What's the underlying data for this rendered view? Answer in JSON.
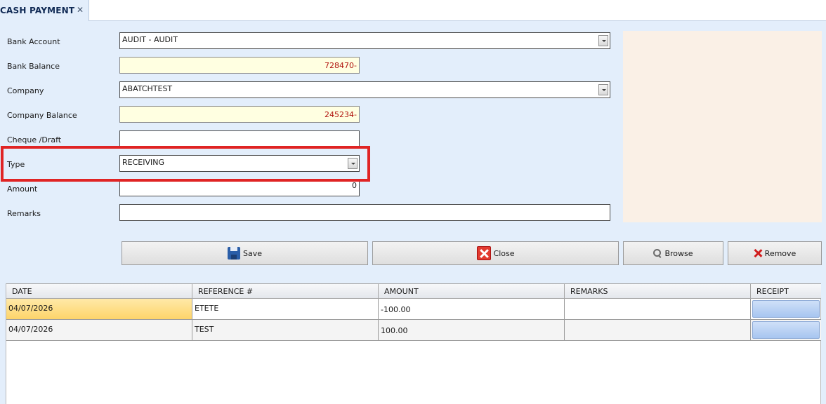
{
  "tab": {
    "title": "CASH PAYMENT",
    "close": "✕"
  },
  "form": {
    "bank_account": {
      "label": "Bank Account",
      "value": "AUDIT - AUDIT"
    },
    "bank_balance": {
      "label": "Bank Balance",
      "value": "728470-"
    },
    "company": {
      "label": "Company",
      "value": "ABATCHTEST"
    },
    "company_balance": {
      "label": "Company Balance",
      "value": "245234-"
    },
    "cheque": {
      "label": "Cheque /Draft",
      "value": ""
    },
    "type": {
      "label": "Type",
      "value": "RECEIVING"
    },
    "amount": {
      "label": "Amount",
      "value": "0"
    },
    "remarks": {
      "label": "Remarks",
      "value": ""
    }
  },
  "buttons": {
    "save": "Save",
    "close": "Close",
    "browse": "Browse",
    "remove": "Remove"
  },
  "grid": {
    "columns": [
      "DATE",
      "REFERENCE #",
      "AMOUNT",
      "REMARKS",
      "RECEIPT"
    ],
    "rows": [
      {
        "date": "04/07/2026",
        "reference": "ETETE",
        "amount": "-100.00",
        "remarks": ""
      },
      {
        "date": "04/07/2026",
        "reference": "TEST",
        "amount": "100.00",
        "remarks": ""
      }
    ]
  },
  "colors": {
    "panel": "#e3eefb",
    "highlight": "#e02424",
    "balance_text": "#b0130e",
    "preview": "#faf0e6"
  }
}
